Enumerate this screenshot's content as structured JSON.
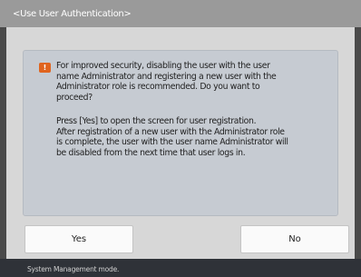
{
  "header": {
    "title": "<Use User Authentication>"
  },
  "dialog": {
    "icon": "warning-icon",
    "message_1": "For improved security, disabling the user with the user\nname Administrator and registering a new user with the\nAdministrator role is recommended. Do you want to\nproceed?",
    "message_2": "Press [Yes] to open the screen for user registration.\nAfter registration of a new user with the Administrator role\nis complete, the user with the user name Administrator will\nbe disabled from the next time that user logs in."
  },
  "buttons": {
    "yes": "Yes",
    "no": "No"
  },
  "status_bar": {
    "text": "System Management mode.",
    "icon": "system-management-icon"
  },
  "colors": {
    "accent": "#e0641e",
    "status_icon": "#5b7fc2"
  }
}
